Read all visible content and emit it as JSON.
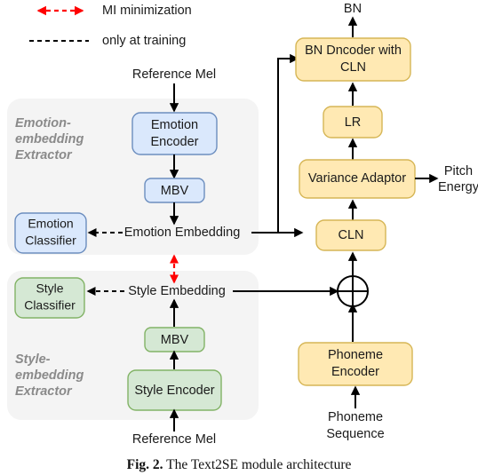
{
  "figure": {
    "caption_prefix": "Fig. 2.",
    "caption_text": "The Text2SE module architecture"
  },
  "legend": {
    "items": [
      {
        "label": "MI minimization",
        "style": "red-dashed-double-arrow",
        "color": "#ff0000"
      },
      {
        "label": "only at training",
        "style": "black-dashed-line",
        "color": "#000000"
      }
    ]
  },
  "panels": [
    {
      "id": "emotion-extractor",
      "title_line1": "Emotion-",
      "title_line2": "embedding",
      "title_line3": "Extractor"
    },
    {
      "id": "style-extractor",
      "title_line1": "Style-",
      "title_line2": "embedding",
      "title_line3": "Extractor"
    }
  ],
  "nodes": {
    "emotion_encoder": {
      "line1": "Emotion",
      "line2": "Encoder",
      "color": "#dae8fc",
      "border": "#6c8ebf"
    },
    "emotion_mbv": {
      "line1": "MBV",
      "color": "#dae8fc",
      "border": "#6c8ebf"
    },
    "emotion_classifier": {
      "line1": "Emotion",
      "line2": "Classifier",
      "color": "#dae8fc",
      "border": "#6c8ebf"
    },
    "style_classifier": {
      "line1": "Style",
      "line2": "Classifier",
      "color": "#d5e8d4",
      "border": "#82b366"
    },
    "style_mbv": {
      "line1": "MBV",
      "color": "#d5e8d4",
      "border": "#82b366"
    },
    "style_encoder": {
      "line1": "Style Encoder",
      "color": "#d5e8d4",
      "border": "#82b366"
    },
    "bn_decoder": {
      "line1": "BN Dncoder with",
      "line2": "CLN",
      "color": "#ffe9b3",
      "border": "#d6b656"
    },
    "lr": {
      "line1": "LR",
      "color": "#ffe9b3",
      "border": "#d6b656"
    },
    "variance_adaptor": {
      "line1": "Variance Adaptor",
      "color": "#ffe9b3",
      "border": "#d6b656"
    },
    "cln": {
      "line1": "CLN",
      "color": "#ffe9b3",
      "border": "#d6b656"
    },
    "phoneme_encoder": {
      "line1": "Phoneme",
      "line2": "Encoder",
      "color": "#ffe9b3",
      "border": "#d6b656"
    }
  },
  "signals": {
    "emotion_embedding": "Emotion Embedding",
    "style_embedding": "Style Embedding",
    "add_operator": "+"
  },
  "io": {
    "reference_mel_top": "Reference Mel",
    "reference_mel_bottom": "Reference Mel",
    "bn_output": "BN",
    "pitch": "Pitch",
    "energy": "Energy",
    "phoneme_sequence_line1": "Phoneme",
    "phoneme_sequence_line2": "Sequence"
  }
}
